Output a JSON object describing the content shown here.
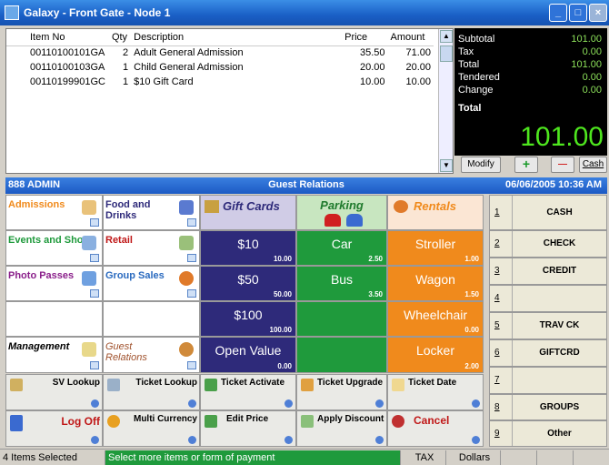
{
  "window": {
    "title": "Galaxy - Front Gate - Node 1"
  },
  "transaction": {
    "headers": [
      "Item No",
      "Qty",
      "Description",
      "Price",
      "Amount"
    ],
    "rows": [
      {
        "item": "00110100101GA",
        "qty": "2",
        "desc": "Adult General Admission",
        "price": "35.50",
        "amount": "71.00"
      },
      {
        "item": "00110100103GA",
        "qty": "1",
        "desc": "Child General Admission",
        "price": "20.00",
        "amount": "20.00"
      },
      {
        "item": "00110199901GC",
        "qty": "1",
        "desc": "$10 Gift Card",
        "price": "10.00",
        "amount": "10.00"
      }
    ]
  },
  "totals": {
    "subtotal_label": "Subtotal",
    "subtotal": "101.00",
    "tax_label": "Tax",
    "tax": "0.00",
    "total_label": "Total",
    "total": "101.00",
    "tendered_label": "Tendered",
    "tendered": "0.00",
    "change_label": "Change",
    "change": "0.00",
    "total2_label": "Total",
    "big_total": "101.00"
  },
  "controls": {
    "modify": "Modify",
    "plus": "+",
    "minus": "—",
    "cash": "Cash"
  },
  "status": {
    "user": "888 ADMIN",
    "mode": "Guest Relations",
    "datetime": "06/06/2005 10:36 AM"
  },
  "categories": {
    "admissions": "Admissions",
    "food_drinks": "Food and Drinks",
    "gift_cards": "Gift Cards",
    "parking": "Parking",
    "rentals": "Rentals",
    "events_shows": "Events and Shows",
    "retail": "Retail",
    "photo_passes": "Photo Passes",
    "group_sales": "Group Sales",
    "management": "Management",
    "guest_relations": "Guest Relations"
  },
  "products": {
    "gc10": {
      "name": "$10",
      "price": "10.00"
    },
    "gc50": {
      "name": "$50",
      "price": "50.00"
    },
    "gc100": {
      "name": "$100",
      "price": "100.00"
    },
    "open_value": {
      "name": "Open Value",
      "price": "0.00"
    },
    "car": {
      "name": "Car",
      "price": "2.50"
    },
    "bus": {
      "name": "Bus",
      "price": "3.50"
    },
    "stroller": {
      "name": "Stroller",
      "price": "1.00"
    },
    "wagon": {
      "name": "Wagon",
      "price": "1.50"
    },
    "wheelchair": {
      "name": "Wheelchair",
      "price": "0.00"
    },
    "locker": {
      "name": "Locker",
      "price": "2.00"
    }
  },
  "functions": {
    "sv_lookup": "SV Lookup",
    "ticket_lookup": "Ticket Lookup",
    "ticket_activate": "Ticket Activate",
    "ticket_upgrade": "Ticket Upgrade",
    "ticket_date": "Ticket Date",
    "log_off": "Log Off",
    "multi_currency": "Multi Currency",
    "edit_price": "Edit Price",
    "apply_discount": "Apply Discount",
    "cancel": "Cancel"
  },
  "tenders": [
    {
      "num": "1",
      "label": "CASH"
    },
    {
      "num": "2",
      "label": "CHECK"
    },
    {
      "num": "3",
      "label": "CREDIT"
    },
    {
      "num": "4",
      "label": ""
    },
    {
      "num": "5",
      "label": "TRAV CK"
    },
    {
      "num": "6",
      "label": "GIFTCRD"
    },
    {
      "num": "7",
      "label": ""
    },
    {
      "num": "8",
      "label": "GROUPS"
    },
    {
      "num": "9",
      "label": "Other"
    }
  ],
  "footer": {
    "selected": "4 Items Selected",
    "prompt": "Select more items or form of payment",
    "tax": "TAX",
    "currency": "Dollars"
  },
  "colors": {
    "navy": "#2e2a7a",
    "green": "#1f9a3c",
    "orange": "#f08a1c",
    "title_blue": "#1a5fc6"
  }
}
